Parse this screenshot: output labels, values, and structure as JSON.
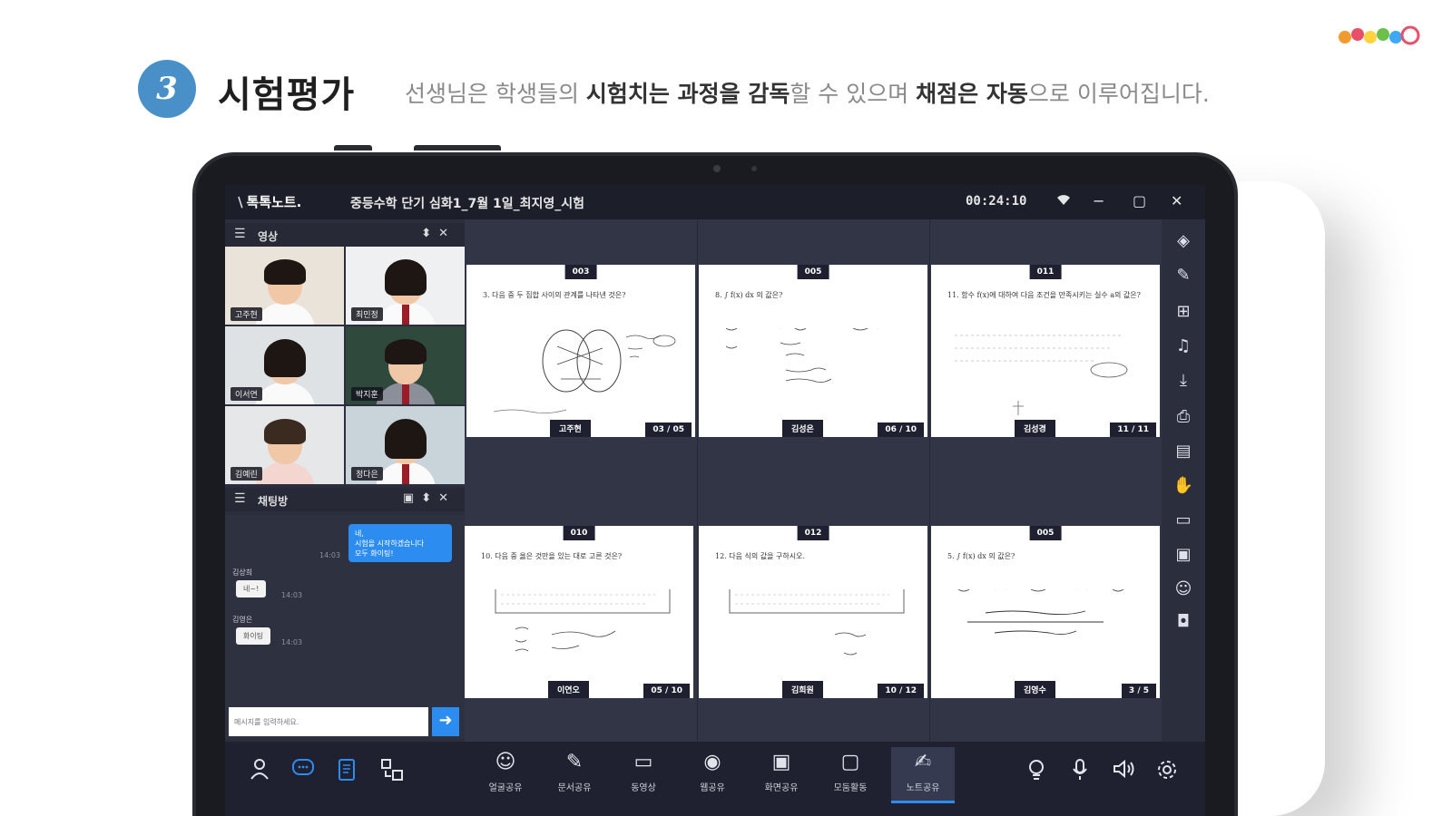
{
  "headline": {
    "step_number": "3",
    "title": "시험평가",
    "desc_parts": [
      {
        "text": "선생님은 학생들의 ",
        "bold": false
      },
      {
        "text": "시험치는 과정을 감독",
        "bold": true
      },
      {
        "text": "할 수 있으며 ",
        "bold": false
      },
      {
        "text": "채점은 자동",
        "bold": true
      },
      {
        "text": "으로 이루어집니다.",
        "bold": false
      }
    ]
  },
  "app": {
    "logo": "톡톡노트.",
    "doc_title": "중등수학 단기 심화1_7월 1일_최지영_시험",
    "timer": "00:24:10",
    "colors": {
      "accent": "#2d8cf0",
      "titlebar": "#1c1e29",
      "panel": "#2b2e3c"
    }
  },
  "video_panel": {
    "title": "영상",
    "participants": [
      "고주현",
      "최민정",
      "이서연",
      "박지훈",
      "김예린",
      "정다은"
    ]
  },
  "chat_panel": {
    "title": "채팅방",
    "my_message": "네,\n시험을 시작하겠습니다\n모두 화이팅!",
    "my_time": "14:03",
    "messages": [
      {
        "sender": "김상희",
        "text": "네~!",
        "time": "14:03"
      },
      {
        "sender": "김영은",
        "text": "화이팅",
        "time": "14:03"
      }
    ],
    "input_placeholder": "메시지를 입력하세요."
  },
  "cards": [
    {
      "num": "003",
      "problem": "3. 다음 중 두 집합 사이의 관계를 나타낸 것은?",
      "student": "고주현",
      "page": "03 / 05"
    },
    {
      "num": "005",
      "problem": "8. ∫ f(x) dx 의 값은?",
      "student": "김성은",
      "page": "06 / 10"
    },
    {
      "num": "011",
      "problem": "11. 함수 f(x)에 대하여 다음 조건을 만족시키는 실수 a의 값은?",
      "student": "김성경",
      "page": "11 / 11"
    },
    {
      "num": "010",
      "problem": "10. 다음 중 옳은 것만을 있는 대로 고른 것은?",
      "student": "이연오",
      "page": "05 / 10"
    },
    {
      "num": "012",
      "problem": "12. 다음 식의 값을 구하시오.",
      "student": "김희원",
      "page": "10 / 12"
    },
    {
      "num": "005",
      "problem": "5. ∫ f(x) dx 의 값은?",
      "student": "김영수",
      "page": "3 / 5"
    }
  ],
  "right_tools": [
    "paint-icon",
    "pen-icon",
    "grid-icon",
    "headset-icon",
    "download-icon",
    "print-icon",
    "board-icon",
    "hand-icon",
    "screen-check-icon",
    "portrait-icon",
    "face-icon",
    "vr-icon"
  ],
  "bottom_toolbar": {
    "left_icons": [
      "person-icon",
      "chat-icon",
      "tablet-icon",
      "share-icon"
    ],
    "buttons": [
      {
        "label": "얼굴공유",
        "icon": "face-share-icon",
        "glyph": "☺"
      },
      {
        "label": "문서공유",
        "icon": "doc-share-icon",
        "glyph": "✎"
      },
      {
        "label": "동영상",
        "icon": "video-icon",
        "glyph": "▭"
      },
      {
        "label": "웹공유",
        "icon": "web-icon",
        "glyph": "◉"
      },
      {
        "label": "화면공유",
        "icon": "screen-share-icon",
        "glyph": "▣"
      },
      {
        "label": "모둠활동",
        "icon": "group-icon",
        "glyph": "▢"
      },
      {
        "label": "노트공유",
        "icon": "note-share-icon",
        "glyph": "✍",
        "active": true
      }
    ],
    "right_icons": [
      "lightbulb-icon",
      "mic-icon",
      "speaker-icon",
      "settings-icon"
    ]
  }
}
